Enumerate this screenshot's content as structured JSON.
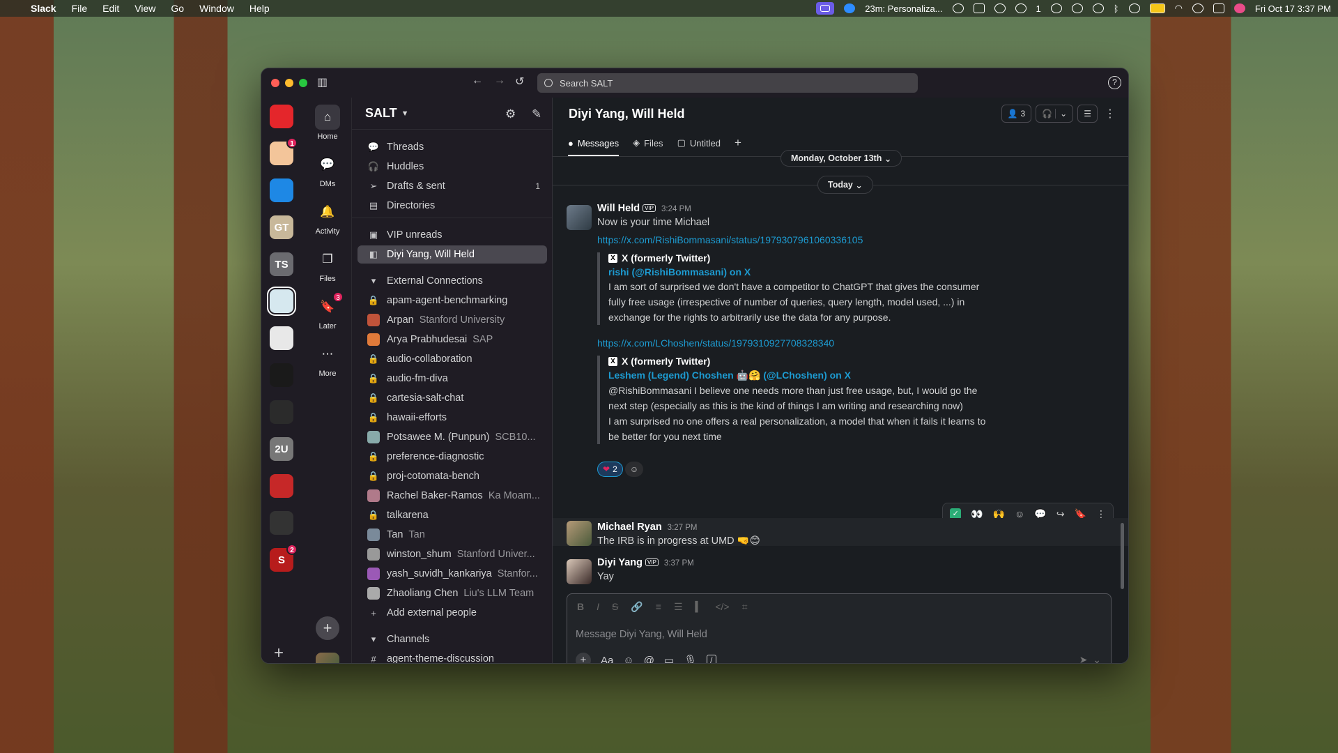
{
  "menubar": {
    "app": "Slack",
    "items": [
      "File",
      "Edit",
      "View",
      "Go",
      "Window",
      "Help"
    ],
    "status_timer": "23m: Personaliza...",
    "badge_count": "1",
    "datetime": "Fri Oct 17  3:37 PM"
  },
  "search": {
    "placeholder": "Search SALT"
  },
  "rail": {
    "workspaces": [
      {
        "label": "",
        "color": "#e4262b",
        "badge": ""
      },
      {
        "label": "",
        "color": "#f3c59a",
        "badge": "1"
      },
      {
        "label": "",
        "color": "#1e88e5",
        "badge": ""
      },
      {
        "label": "GT",
        "color": "#c8b89a",
        "badge": ""
      },
      {
        "label": "TS",
        "color": "#6b6b70",
        "badge": ""
      },
      {
        "label": "",
        "color": "#d6e8ef",
        "badge": ""
      },
      {
        "label": "",
        "color": "#e8e8e8",
        "badge": ""
      },
      {
        "label": "",
        "color": "#1a1a1a",
        "badge": ""
      },
      {
        "label": "",
        "color": "#2b2b2b",
        "badge": ""
      },
      {
        "label": "2U",
        "color": "#777",
        "badge": ""
      },
      {
        "label": "",
        "color": "#c62828",
        "badge": ""
      },
      {
        "label": "",
        "color": "#333",
        "badge": ""
      },
      {
        "label": "S",
        "color": "#b71c1c",
        "badge": "2"
      }
    ]
  },
  "nav": {
    "items": [
      {
        "label": "Home",
        "icon": "home-icon"
      },
      {
        "label": "DMs",
        "icon": "dms-icon"
      },
      {
        "label": "Activity",
        "icon": "bell-icon"
      },
      {
        "label": "Files",
        "icon": "files-icon"
      },
      {
        "label": "Later",
        "icon": "bookmark-icon",
        "badge": "3"
      },
      {
        "label": "More",
        "icon": "more-icon"
      }
    ]
  },
  "sidebar": {
    "workspace": "SALT",
    "top": [
      {
        "label": "Threads"
      },
      {
        "label": "Huddles"
      },
      {
        "label": "Drafts & sent",
        "count": "1"
      },
      {
        "label": "Directories"
      }
    ],
    "vip": "VIP unreads",
    "selected": "Diyi Yang, Will Held",
    "section_external": "External Connections",
    "external": [
      {
        "label": "apam-agent-benchmarking",
        "sub": "",
        "kind": "lock"
      },
      {
        "label": "Arpan",
        "sub": "Stanford University",
        "kind": "avatar",
        "color": "#c0533a"
      },
      {
        "label": "Arya Prabhudesai",
        "sub": "SAP",
        "kind": "avatar",
        "color": "#e07a3a"
      },
      {
        "label": "audio-collaboration",
        "sub": "",
        "kind": "lock"
      },
      {
        "label": "audio-fm-diva",
        "sub": "",
        "kind": "lock"
      },
      {
        "label": "cartesia-salt-chat",
        "sub": "",
        "kind": "lock"
      },
      {
        "label": "hawaii-efforts",
        "sub": "",
        "kind": "lock"
      },
      {
        "label": "Potsawee M. (Punpun)",
        "sub": "SCB10...",
        "kind": "avatar",
        "color": "#8aa"
      },
      {
        "label": "preference-diagnostic",
        "sub": "",
        "kind": "lock"
      },
      {
        "label": "proj-cotomata-bench",
        "sub": "",
        "kind": "lock"
      },
      {
        "label": "Rachel Baker-Ramos",
        "sub": "Ka Moam...",
        "kind": "avatar",
        "color": "#b07a8a"
      },
      {
        "label": "talkarena",
        "sub": "",
        "kind": "lock"
      },
      {
        "label": "Tan",
        "sub": "Tan",
        "kind": "avatar",
        "color": "#7a8a9a"
      },
      {
        "label": "winston_shum",
        "sub": "Stanford Univer...",
        "kind": "avatar",
        "color": "#999"
      },
      {
        "label": "yash_suvidh_kankariya",
        "sub": "Stanfor...",
        "kind": "avatar",
        "color": "#9b59b6"
      },
      {
        "label": "Zhaoliang Chen",
        "sub": "Liu's LLM Team",
        "kind": "avatar",
        "color": "#aaa"
      }
    ],
    "add_external": "Add external people",
    "section_channels": "Channels",
    "next_channel": "agent-theme-discussion"
  },
  "main": {
    "title": "Diyi Yang, Will Held",
    "member_count": "3",
    "tabs": [
      {
        "label": "Messages"
      },
      {
        "label": "Files"
      },
      {
        "label": "Untitled"
      }
    ],
    "date_old": "Monday, October 13th",
    "date_today": "Today",
    "messages": [
      {
        "author": "Will Held",
        "vip": "VIP",
        "time": "3:24 PM",
        "text": "Now is your time Michael",
        "link1": "https://x.com/RishiBommasani/status/1979307961060336105",
        "unfurl1": {
          "source": "X (formerly Twitter)",
          "author": "rishi (@RishiBommasani) on X",
          "body": "I am sort of surprised we don't have a competitor to ChatGPT that gives the consumer fully free usage (irrespective of number of queries, query length, model used, ...) in exchange for the rights to arbitrarily use the data for any purpose."
        },
        "link2": "https://x.com/LChoshen/status/1979310927708328340",
        "unfurl2": {
          "source": "X (formerly Twitter)",
          "author": "Leshem (Legend) Choshen 🤖🤗 (@LChoshen) on X",
          "body": "@RishiBommasani I believe one needs more than just free usage, but, I would go the next step (especially as this is the kind of things I am writing and researching now)\nI am surprised no one offers a real personalization, a model that when it fails it learns to be better for you next time"
        },
        "reaction": "2"
      },
      {
        "author": "Michael Ryan",
        "time": "3:27 PM",
        "text": "The IRB is in progress at UMD 🤜😊"
      },
      {
        "author": "Diyi Yang",
        "vip": "VIP",
        "time": "3:37 PM",
        "text": "Yay"
      }
    ],
    "composer": {
      "placeholder": "Message Diyi Yang, Will Held"
    }
  }
}
